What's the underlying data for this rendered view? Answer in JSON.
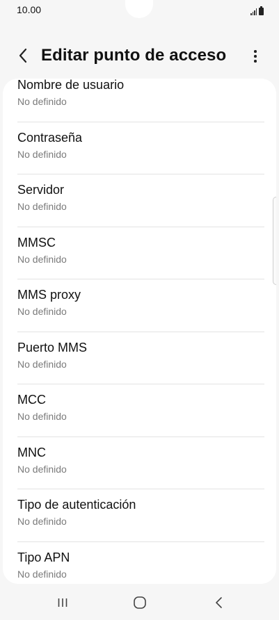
{
  "status_bar": {
    "time": "10.00",
    "icons": [
      "signal-icon",
      "battery-icon"
    ]
  },
  "header": {
    "back_icon": "chevron-left-icon",
    "title": "Editar punto de acceso",
    "more_icon": "more-vertical-icon"
  },
  "list": {
    "items": [
      {
        "title": "Nombre de usuario",
        "value": "No definido"
      },
      {
        "title": "Contraseña",
        "value": "No definido"
      },
      {
        "title": "Servidor",
        "value": "No definido"
      },
      {
        "title": "MMSC",
        "value": "No definido"
      },
      {
        "title": "MMS proxy",
        "value": "No definido"
      },
      {
        "title": "Puerto MMS",
        "value": "No definido"
      },
      {
        "title": "MCC",
        "value": "No definido"
      },
      {
        "title": "MNC",
        "value": "No definido"
      },
      {
        "title": "Tipo de autenticación",
        "value": "No definido"
      },
      {
        "title": "Tipo APN",
        "value": "No definido"
      }
    ]
  },
  "nav_bar": {
    "icons": [
      "recent-apps-icon",
      "home-icon",
      "back-icon"
    ]
  }
}
